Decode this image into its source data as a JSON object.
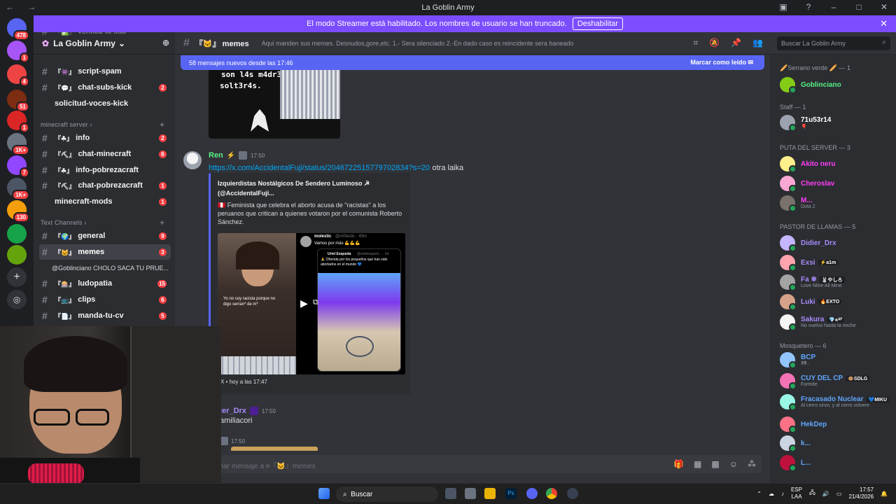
{
  "window": {
    "title": "La Goblin Army"
  },
  "banner": {
    "text": "El modo Streamer está habilitado. Los nombres de usuario se han truncado.",
    "button": "Deshabilitar"
  },
  "servers": [
    {
      "badge": "478",
      "color": "#5865f2"
    },
    {
      "badge": "1",
      "color": "#a855f7"
    },
    {
      "badge": "4",
      "color": "#ef4444"
    },
    {
      "badge": "51",
      "color": "#7c2d12"
    },
    {
      "badge": "1",
      "color": "#dc2626"
    },
    {
      "badge": "1K+",
      "color": "#6b7280"
    },
    {
      "badge": "7",
      "color": "#9146ff"
    },
    {
      "badge": "1K+",
      "color": "#4b5563"
    },
    {
      "badge": "130",
      "color": "#f59e0b"
    },
    {
      "badge": "",
      "color": "#16a34a"
    },
    {
      "badge": "",
      "color": "#65a30d"
    }
  ],
  "guild": {
    "name": "La Goblin Army"
  },
  "channels": {
    "top": [
      {
        "name": "verifica-tu-sub",
        "prefix": "『✅』",
        "badge": ""
      },
      {
        "name": "script-spam",
        "prefix": "『👾』",
        "badge": ""
      },
      {
        "name": "chat-subs-kick",
        "prefix": "『💬』",
        "badge": "2"
      },
      {
        "name": "solicitud-voces-kick",
        "prefix": "",
        "badge": ""
      }
    ],
    "minecraft_label": "minecraft server",
    "minecraft": [
      {
        "name": "info",
        "prefix": "『☘』",
        "badge": "2"
      },
      {
        "name": "chat-minecraft",
        "prefix": "『⛏』",
        "badge": "6"
      },
      {
        "name": "info-pobrezacraft",
        "prefix": "『☘』",
        "badge": ""
      },
      {
        "name": "chat-pobrezacraft",
        "prefix": "『⛏』",
        "badge": "1"
      },
      {
        "name": "minecraft-mods",
        "prefix": "",
        "badge": "1"
      }
    ],
    "text_label": "Text Channels",
    "text": [
      {
        "name": "general",
        "prefix": "『🌍』",
        "badge": "9"
      },
      {
        "name": "memes",
        "prefix": "『🐱』",
        "badge": "3"
      },
      {
        "name": "ludopatia",
        "prefix": "『🎰』",
        "badge": "15"
      },
      {
        "name": "clips",
        "prefix": "『📺』",
        "badge": "6"
      },
      {
        "name": "manda-tu-cv",
        "prefix": "『📄』",
        "badge": "5"
      }
    ],
    "thread": "@Goblinciano CHOLO SACA TU PRUE..."
  },
  "header": {
    "channel": "memes",
    "prefix": "『🐱』",
    "topic": "Aqui manden sus memes. Desnudos,gore,etc. 1.- Sera silenciado 2.-En dado caso es reincidente sera baneado",
    "search_placeholder": "Buscar La Goblin Army"
  },
  "new_messages": {
    "text": "58 mensajes nuevos desde las 17:46",
    "mark": "Marcar como leído"
  },
  "preview_image": {
    "line1": "son l4s m4dr3s",
    "line2": "solt3r4s."
  },
  "message1": {
    "author": "Ren",
    "time": "17:50",
    "link": "https://x.com/AccidentalFuji/status/2046722515779702834?s=20",
    "text": "otra laika",
    "embed": {
      "title": "Izquierdistas Nostálgicos De Sendero Luminoso ☭ (@AccidentalFuji...",
      "desc": "🇵🇪 Feminista que celebra el aborto acusa de \"racistas\" a los peruanos que critican a quienes votaron por el comunista Roberto Sánchez.",
      "tweet_user": "molestic",
      "tweet_handle": "@m0lestic · 49m",
      "tweet_text": "Vamos por más 💪💪💪",
      "quote_user": "Uriel Esqueda",
      "quote_handle": "@urielesqued... · 1d",
      "quote_text": "🙏 Ofrenda por los pequeños que han sido abortados en el mundo 💙",
      "video_caption": "Yo no soy racista porque no digo serran* de m*",
      "footer": "X • hoy a las 17:47"
    }
  },
  "message2": {
    "author": "ier_Drx",
    "time": "17:50",
    "text": "amiliacori"
  },
  "message3": {
    "time": "17:50"
  },
  "composer": {
    "placeholder": "viar mensaje a #『🐱』memes"
  },
  "members": {
    "groups": [
      {
        "label": "🥖Serrano verde 🥖 — 1",
        "members": [
          {
            "name": "Goblinciano",
            "sub": "",
            "tag": "",
            "color": "#57f287"
          }
        ]
      },
      {
        "label": "Staff — 1",
        "members": [
          {
            "name": "71u53r14",
            "sub": "🎈",
            "tag": "",
            "color": "#ffffff"
          }
        ]
      },
      {
        "label": "PUTA DEL SERVER — 3",
        "members": [
          {
            "name": "Akito neru",
            "sub": "",
            "tag": "",
            "color": "#ff3df7"
          },
          {
            "name": "Cheroslav",
            "sub": "",
            "tag": "",
            "color": "#ff3df7"
          },
          {
            "name": "M...",
            "sub": "Dota 2",
            "tag": "",
            "color": "#ff3df7"
          }
        ]
      },
      {
        "label": "PASTOR DE LLAMAS — 5",
        "members": [
          {
            "name": "Didier_Drx",
            "sub": "",
            "tag": "",
            "color": "#a78bfa"
          },
          {
            "name": "Exsi",
            "sub": "",
            "tag": "⚡a1m",
            "color": "#a78bfa"
          },
          {
            "name": "Fa ❄",
            "sub": "Love Mine All Mine",
            "tag": "🐰やしろ",
            "color": "#a78bfa"
          },
          {
            "name": "Luki",
            "sub": "",
            "tag": "🔥EXTO",
            "color": "#a78bfa"
          },
          {
            "name": "Sakura",
            "sub": "No vuelvo hasta la noche",
            "tag": "💎ᴋᴬᴾ",
            "color": "#a78bfa"
          }
        ]
      },
      {
        "label": "Mosquetero — 6",
        "members": [
          {
            "name": "BCP",
            "sub": "₮₴..",
            "tag": "",
            "color": "#60a5fa"
          },
          {
            "name": "CUY DEL CP",
            "sub": "Fortnite",
            "tag": "🐵SDLG",
            "color": "#60a5fa"
          },
          {
            "name": "Fracasado Nuclear",
            "sub": "Al cerro sirvo, y al cerro volvere",
            "tag": "💙MIKU",
            "color": "#60a5fa"
          },
          {
            "name": "HekDep",
            "sub": "",
            "tag": "",
            "color": "#60a5fa"
          },
          {
            "name": "k...",
            "sub": "",
            "tag": "",
            "color": "#60a5fa"
          },
          {
            "name": "L...",
            "sub": "",
            "tag": "",
            "color": "#60a5fa"
          }
        ]
      }
    ]
  },
  "taskbar": {
    "search": "Buscar",
    "lang1": "ESP",
    "lang2": "LAA",
    "time": "17:57",
    "date": "21/4/2026"
  }
}
